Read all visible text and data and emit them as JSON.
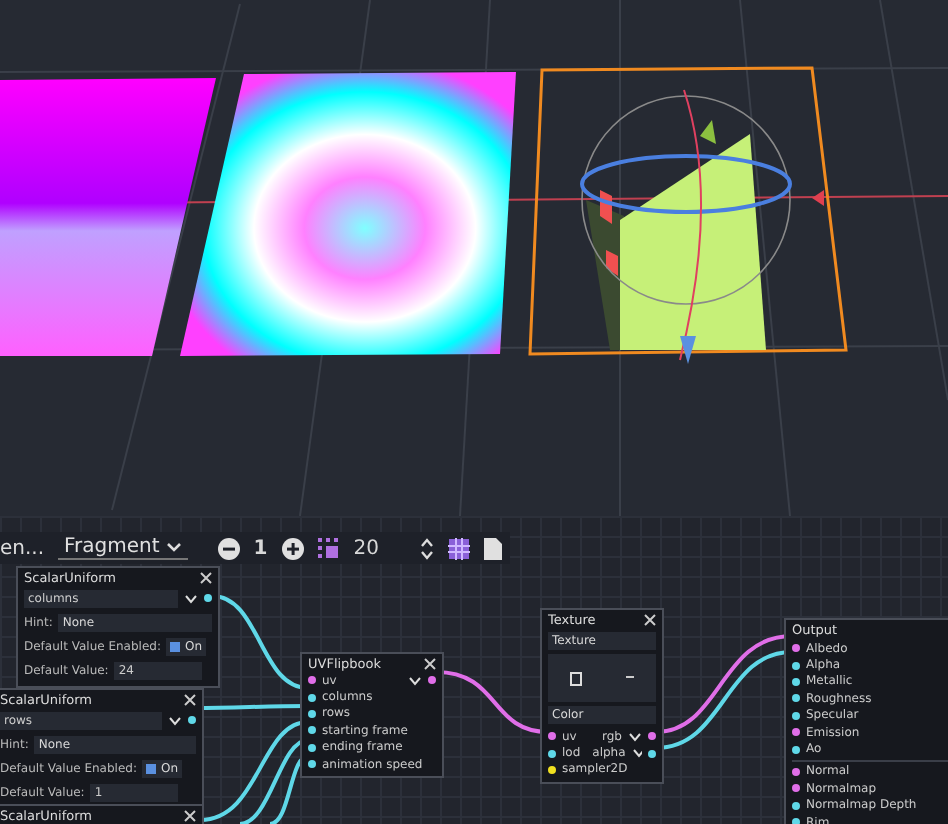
{
  "toolbar": {
    "cut_label": "en...",
    "mode": "Fragment",
    "zoom_level": "1",
    "snap_value": "20"
  },
  "nodes": [
    {
      "kind": "uniform",
      "title": "ScalarUniform",
      "name": "columns",
      "hint_label": "Hint:",
      "hint": "None",
      "enabled_label": "Default Value Enabled:",
      "enabled": true,
      "enabled_text": "On",
      "value_label": "Default Value:",
      "value": "24"
    },
    {
      "kind": "uniform",
      "title": "ScalarUniform",
      "name": "rows",
      "hint_label": "Hint:",
      "hint": "None",
      "enabled_label": "Default Value Enabled:",
      "enabled": true,
      "enabled_text": "On",
      "value_label": "Default Value:",
      "value": "1"
    },
    {
      "kind": "uniform",
      "title": "ScalarUniform"
    },
    {
      "kind": "flipbook",
      "title": "UVFlipbook",
      "rows": [
        {
          "label": "uv",
          "color": "#e06ee8",
          "out": {
            "color": "#e06ee8"
          }
        },
        {
          "label": "columns",
          "color": "#5fd8e8"
        },
        {
          "label": "rows",
          "color": "#5fd8e8"
        },
        {
          "label": "starting frame",
          "color": "#5fd8e8"
        },
        {
          "label": "ending frame",
          "color": "#5fd8e8"
        },
        {
          "label": "animation speed",
          "color": "#5fd8e8"
        }
      ]
    },
    {
      "kind": "texture",
      "title": "Texture",
      "source": "Texture",
      "type": "Color",
      "rows": [
        {
          "label": "uv",
          "color": "#e06ee8",
          "out": {
            "label": "rgb",
            "color": "#e06ee8"
          }
        },
        {
          "label": "lod",
          "color": "#5fd8e8",
          "out": {
            "label": "alpha",
            "color": "#5fd8e8"
          }
        },
        {
          "label": "sampler2D",
          "color": "#f0e020"
        }
      ]
    },
    {
      "kind": "output",
      "title": "Output",
      "groups": [
        [
          {
            "label": "Albedo",
            "color": "#e06ee8"
          },
          {
            "label": "Alpha",
            "color": "#5fd8e8"
          },
          {
            "label": "Metallic",
            "color": "#5fd8e8"
          },
          {
            "label": "Roughness",
            "color": "#5fd8e8"
          },
          {
            "label": "Specular",
            "color": "#5fd8e8"
          },
          {
            "label": "Emission",
            "color": "#e06ee8"
          },
          {
            "label": "Ao",
            "color": "#5fd8e8"
          }
        ],
        [
          {
            "label": "Normal",
            "color": "#e06ee8"
          },
          {
            "label": "Normalmap",
            "color": "#e06ee8"
          },
          {
            "label": "Normalmap Depth",
            "color": "#5fd8e8"
          },
          {
            "label": "Rim",
            "color": "#5fd8e8"
          }
        ]
      ]
    }
  ]
}
